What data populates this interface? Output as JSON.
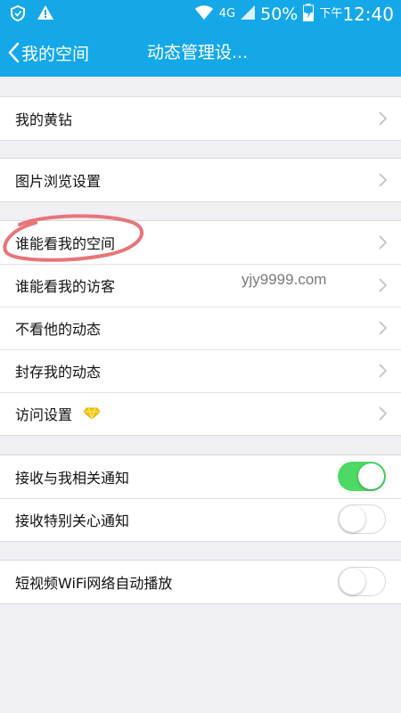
{
  "status_bar": {
    "battery": "50%",
    "network": "4G",
    "period": "下午",
    "time": "12:40"
  },
  "nav": {
    "back_label": "我的空间",
    "title": "动态管理设..."
  },
  "groups": [
    {
      "items": [
        {
          "label": "我的黄钻"
        }
      ]
    },
    {
      "items": [
        {
          "label": "图片浏览设置"
        }
      ]
    },
    {
      "items": [
        {
          "label": "谁能看我的空间"
        },
        {
          "label": "谁能看我的访客"
        },
        {
          "label": "不看他的动态"
        },
        {
          "label": "封存我的动态"
        },
        {
          "label": "访问设置"
        }
      ]
    },
    {
      "items": [
        {
          "label": "接收与我相关通知",
          "toggle": true
        },
        {
          "label": "接收特别关心通知",
          "toggle": false
        }
      ]
    },
    {
      "items": [
        {
          "label": "短视频WiFi网络自动播放",
          "toggle": false
        }
      ]
    }
  ],
  "watermark": "yjy9999.com",
  "colors": {
    "header": "#14a8e9",
    "toggle_on": "#4cd964",
    "annotation": "#e8757a"
  }
}
